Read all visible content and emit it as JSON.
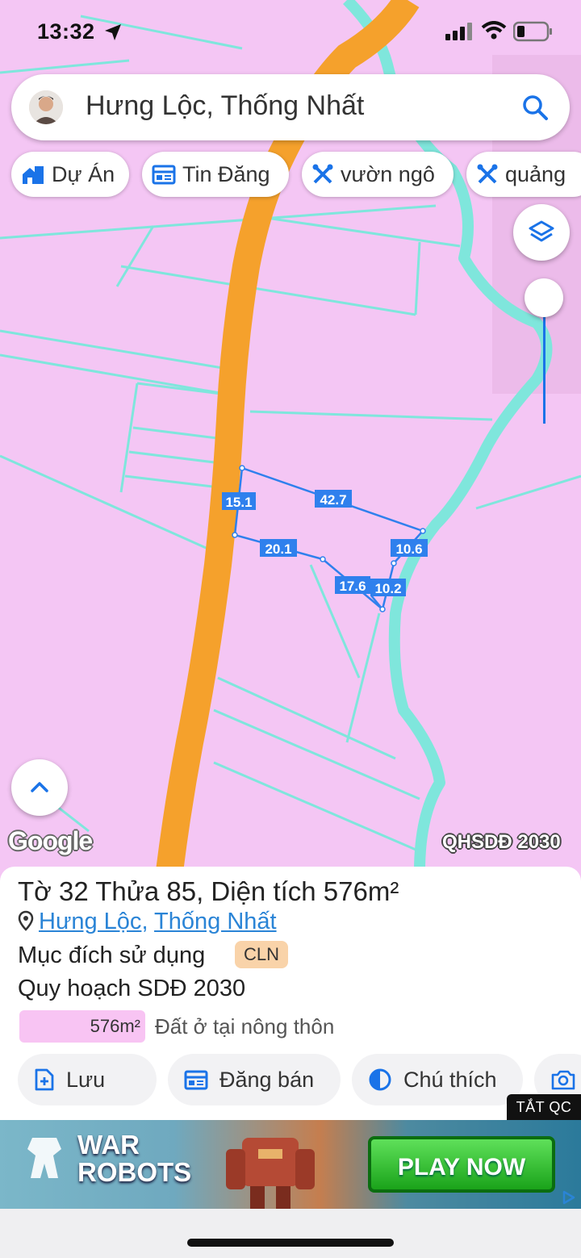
{
  "status_bar": {
    "time": "13:32"
  },
  "search": {
    "text": "Hưng Lộc, Thống Nhất"
  },
  "chips": [
    {
      "label": "Dự Án",
      "icon": "home-city-icon"
    },
    {
      "label": "Tin Đăng",
      "icon": "listing-icon"
    },
    {
      "label": "vườn ngô",
      "icon": "tools-icon"
    },
    {
      "label": "quảng",
      "icon": "tools-icon"
    }
  ],
  "map": {
    "plot_edges": [
      "15.1",
      "42.7",
      "20.1",
      "10.6",
      "17.6",
      "10.2"
    ],
    "attribution": "Google",
    "plan_label": "QHSDĐ 2030",
    "colors": {
      "land": "#f4c6f4",
      "road": "#f5a12c",
      "river": "#7fe6dc",
      "parcel": "#2f80ed"
    }
  },
  "parcel": {
    "title": "Tờ 32 Thửa 85, Diện tích 576m²",
    "ward": "Hưng Lộc",
    "district": "Thống Nhất",
    "purpose_label": "Mục đích sử dụng",
    "purpose_code": "CLN",
    "plan_label": "Quy hoạch SDĐ 2030",
    "area_label": "576m²",
    "land_type": "Đất ở tại nông thôn"
  },
  "actions": {
    "save": "Lưu",
    "post": "Đăng bán",
    "legend": "Chú thích"
  },
  "ad": {
    "dismiss_label": "TẮT QC",
    "brand_line1": "WAR",
    "brand_line2": "ROBOTS",
    "cta": "PLAY NOW"
  }
}
